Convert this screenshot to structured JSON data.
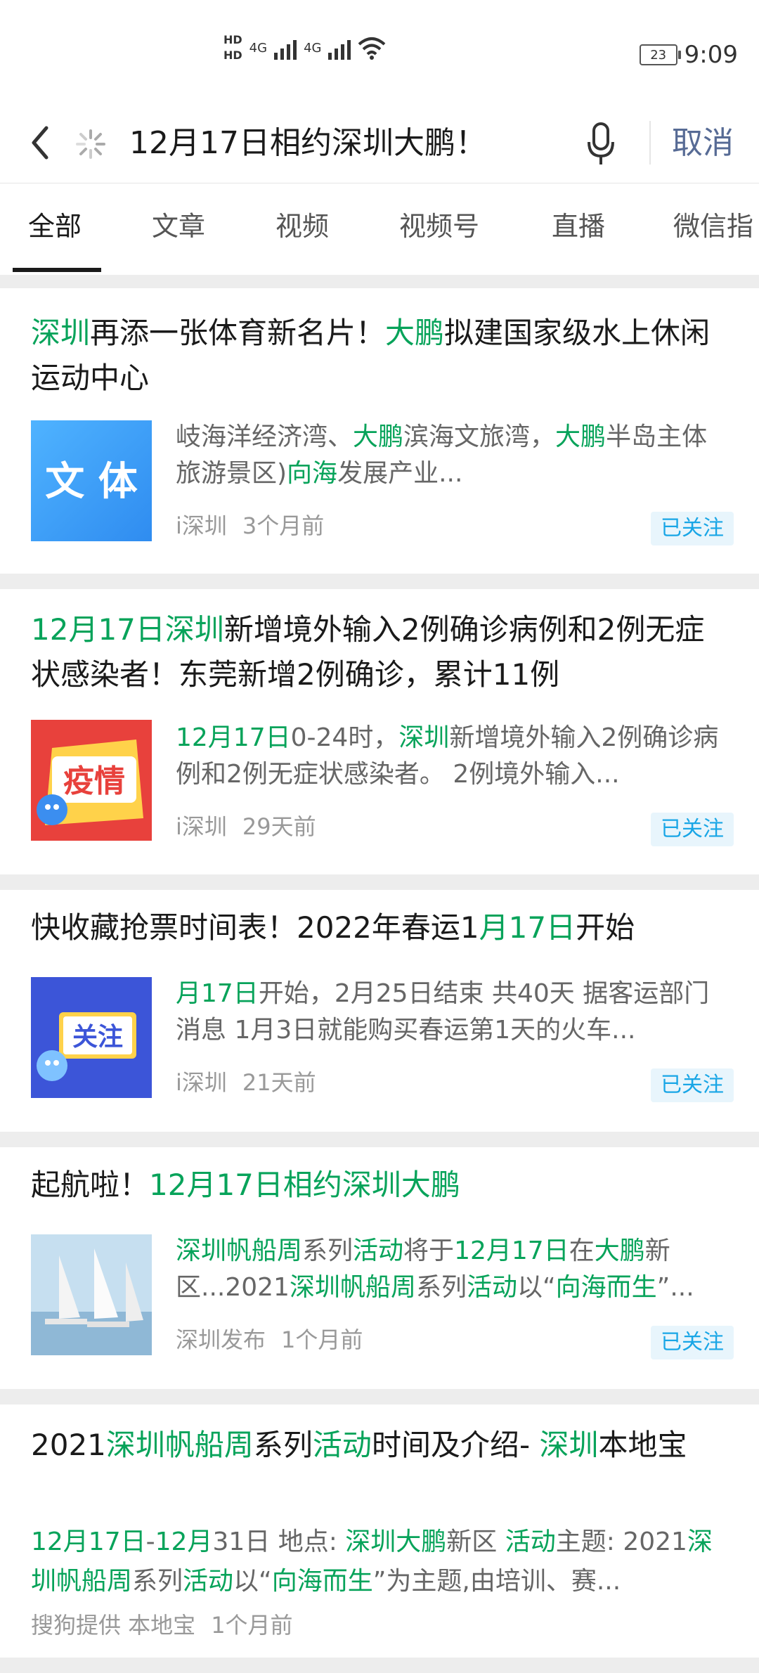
{
  "status": {
    "hd1": "HD",
    "hd2": "HD",
    "net1": "4G",
    "net2": "4G",
    "battery": "23",
    "time": "9:09"
  },
  "search": {
    "query": "12月17日相约深圳大鹏！",
    "cancel_label": "取消"
  },
  "tabs": [
    "全部",
    "文章",
    "视频",
    "视频号",
    "直播",
    "微信指"
  ],
  "results": [
    {
      "title": [
        {
          "t": "深圳",
          "h": true
        },
        {
          "t": "再添一张体育新名片！",
          "h": false
        },
        {
          "t": "大鹏",
          "h": true
        },
        {
          "t": "拟建国家级水上休闲运动中心",
          "h": false
        }
      ],
      "thumb_text": "文 体",
      "desc": [
        {
          "t": "岐海洋经济湾、",
          "h": false
        },
        {
          "t": "大鹏",
          "h": true
        },
        {
          "t": "滨海文旅湾，",
          "h": false
        },
        {
          "t": "大鹏",
          "h": true
        },
        {
          "t": "半岛主体旅游景区)",
          "h": false
        },
        {
          "t": "向海",
          "h": true
        },
        {
          "t": "发展产业...",
          "h": false
        }
      ],
      "source": "i深圳",
      "time": "3个月前",
      "follow": "已关注"
    },
    {
      "title": [
        {
          "t": "12月17日深圳",
          "h": true
        },
        {
          "t": "新增境外输入2例确诊病例和2例无症状感染者！东莞新增2例确诊，累计11例",
          "h": false
        }
      ],
      "thumb_text": "疫情",
      "desc": [
        {
          "t": "12月17日",
          "h": true
        },
        {
          "t": "0-24时，",
          "h": false
        },
        {
          "t": "深圳",
          "h": true
        },
        {
          "t": "新增境外输入2例确诊病例和2例无症状感染者。 2例境外输入...",
          "h": false
        }
      ],
      "source": "i深圳",
      "time": "29天前",
      "follow": "已关注"
    },
    {
      "title": [
        {
          "t": "快收藏抢票时间表！2022年春运1",
          "h": false
        },
        {
          "t": "月17日",
          "h": true
        },
        {
          "t": "开始",
          "h": false
        }
      ],
      "thumb_text": "关注",
      "desc": [
        {
          "t": "月17日",
          "h": true
        },
        {
          "t": "开始，2月25日结束 共40天 据客运部门消息 1月3日就能购买春运第1天的火车...",
          "h": false
        }
      ],
      "source": "i深圳",
      "time": "21天前",
      "follow": "已关注"
    },
    {
      "title": [
        {
          "t": "起航啦！",
          "h": false
        },
        {
          "t": "12月17日相约深圳大鹏",
          "h": true
        }
      ],
      "thumb_text": "",
      "desc": [
        {
          "t": "深圳帆船周",
          "h": true
        },
        {
          "t": "系列",
          "h": false
        },
        {
          "t": "活动",
          "h": true
        },
        {
          "t": "将于",
          "h": false
        },
        {
          "t": "12月17日",
          "h": true
        },
        {
          "t": "在",
          "h": false
        },
        {
          "t": "大鹏",
          "h": true
        },
        {
          "t": "新区...2021",
          "h": false
        },
        {
          "t": "深圳帆船周",
          "h": true
        },
        {
          "t": "系列",
          "h": false
        },
        {
          "t": "活动",
          "h": true
        },
        {
          "t": "以“",
          "h": false
        },
        {
          "t": "向海而生",
          "h": true
        },
        {
          "t": "”...",
          "h": false
        }
      ],
      "source": "深圳发布",
      "time": "1个月前",
      "follow": "已关注"
    },
    {
      "title": [
        {
          "t": "2021",
          "h": false
        },
        {
          "t": "深圳帆船周",
          "h": true
        },
        {
          "t": "系列",
          "h": false
        },
        {
          "t": "活动",
          "h": true
        },
        {
          "t": "时间及介绍- ",
          "h": false
        },
        {
          "t": "深圳",
          "h": true
        },
        {
          "t": "本地宝",
          "h": false
        }
      ],
      "thumb_text": "",
      "desc": [
        {
          "t": "12月17日",
          "h": true
        },
        {
          "t": "-",
          "h": false
        },
        {
          "t": "12月",
          "h": true
        },
        {
          "t": "31日 地点: ",
          "h": false
        },
        {
          "t": "深圳大鹏",
          "h": true
        },
        {
          "t": "新区 ",
          "h": false
        },
        {
          "t": "活动",
          "h": true
        },
        {
          "t": "主题: 2021",
          "h": false
        },
        {
          "t": "深圳帆船周",
          "h": true
        },
        {
          "t": "系列",
          "h": false
        },
        {
          "t": "活动",
          "h": true
        },
        {
          "t": "以“",
          "h": false
        },
        {
          "t": "向海而生",
          "h": true
        },
        {
          "t": "”为主题,由培训、赛...",
          "h": false
        }
      ],
      "source": "搜狗提供 本地宝",
      "time": "1个月前",
      "follow": ""
    }
  ]
}
